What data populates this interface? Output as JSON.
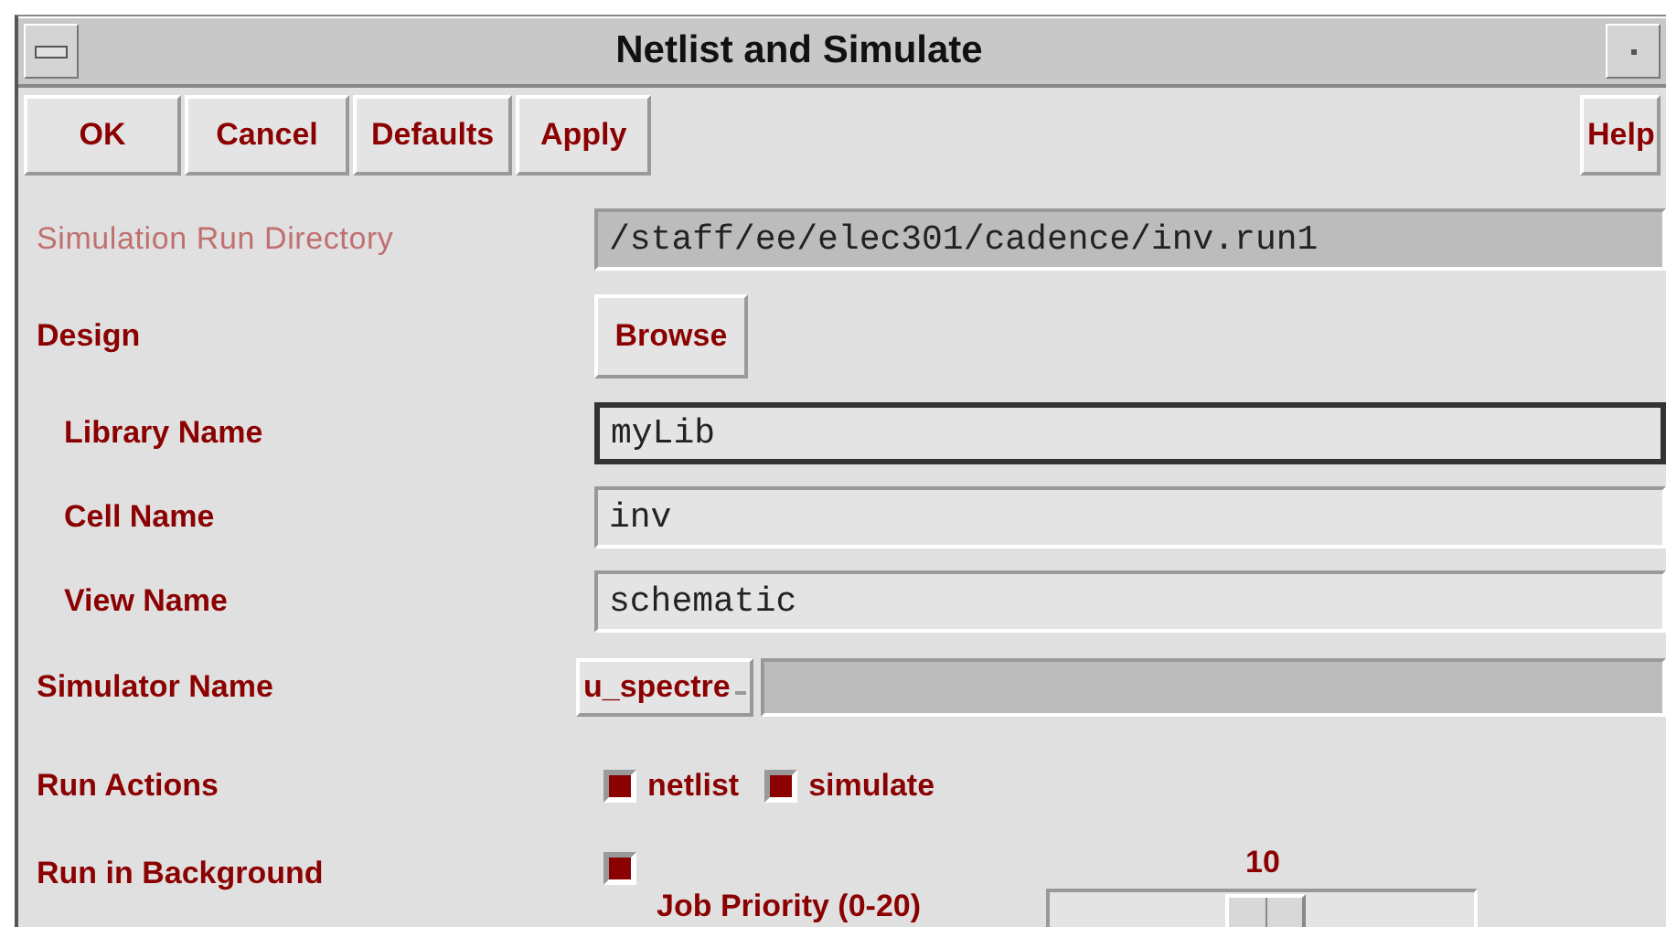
{
  "window": {
    "title": "Netlist and Simulate"
  },
  "buttons": [
    {
      "label": "OK"
    },
    {
      "label": "Cancel"
    },
    {
      "label": "Defaults"
    },
    {
      "label": "Apply"
    }
  ],
  "help_button": {
    "label": "Help"
  },
  "rows": [
    {
      "kind": "field",
      "label": "Simulation Run Directory",
      "value": "/staff/ee/elec301/cadence/inv.run1",
      "disabled": true,
      "focused": false
    },
    {
      "kind": "button",
      "label": "Design",
      "button": "Browse",
      "children": [
        {
          "kind": "field",
          "label": "Library Name",
          "value": "myLib",
          "disabled": false,
          "focused": true
        },
        {
          "kind": "field",
          "label": "Cell Name",
          "value": "inv",
          "disabled": false,
          "focused": false
        },
        {
          "kind": "field",
          "label": "View Name",
          "value": "schematic",
          "disabled": false,
          "focused": false
        }
      ]
    },
    {
      "kind": "cyclic",
      "label": "Simulator Name",
      "value": "u_spectre"
    },
    {
      "kind": "checks",
      "label": "Run Actions",
      "options": [
        {
          "label": "netlist",
          "checked": true
        },
        {
          "label": "simulate",
          "checked": true
        }
      ]
    },
    {
      "kind": "background",
      "label": "Run in Background",
      "checked": true,
      "priority": {
        "label": "Job Priority (0-20)",
        "reading": "10",
        "level": 0.5
      }
    }
  ]
}
